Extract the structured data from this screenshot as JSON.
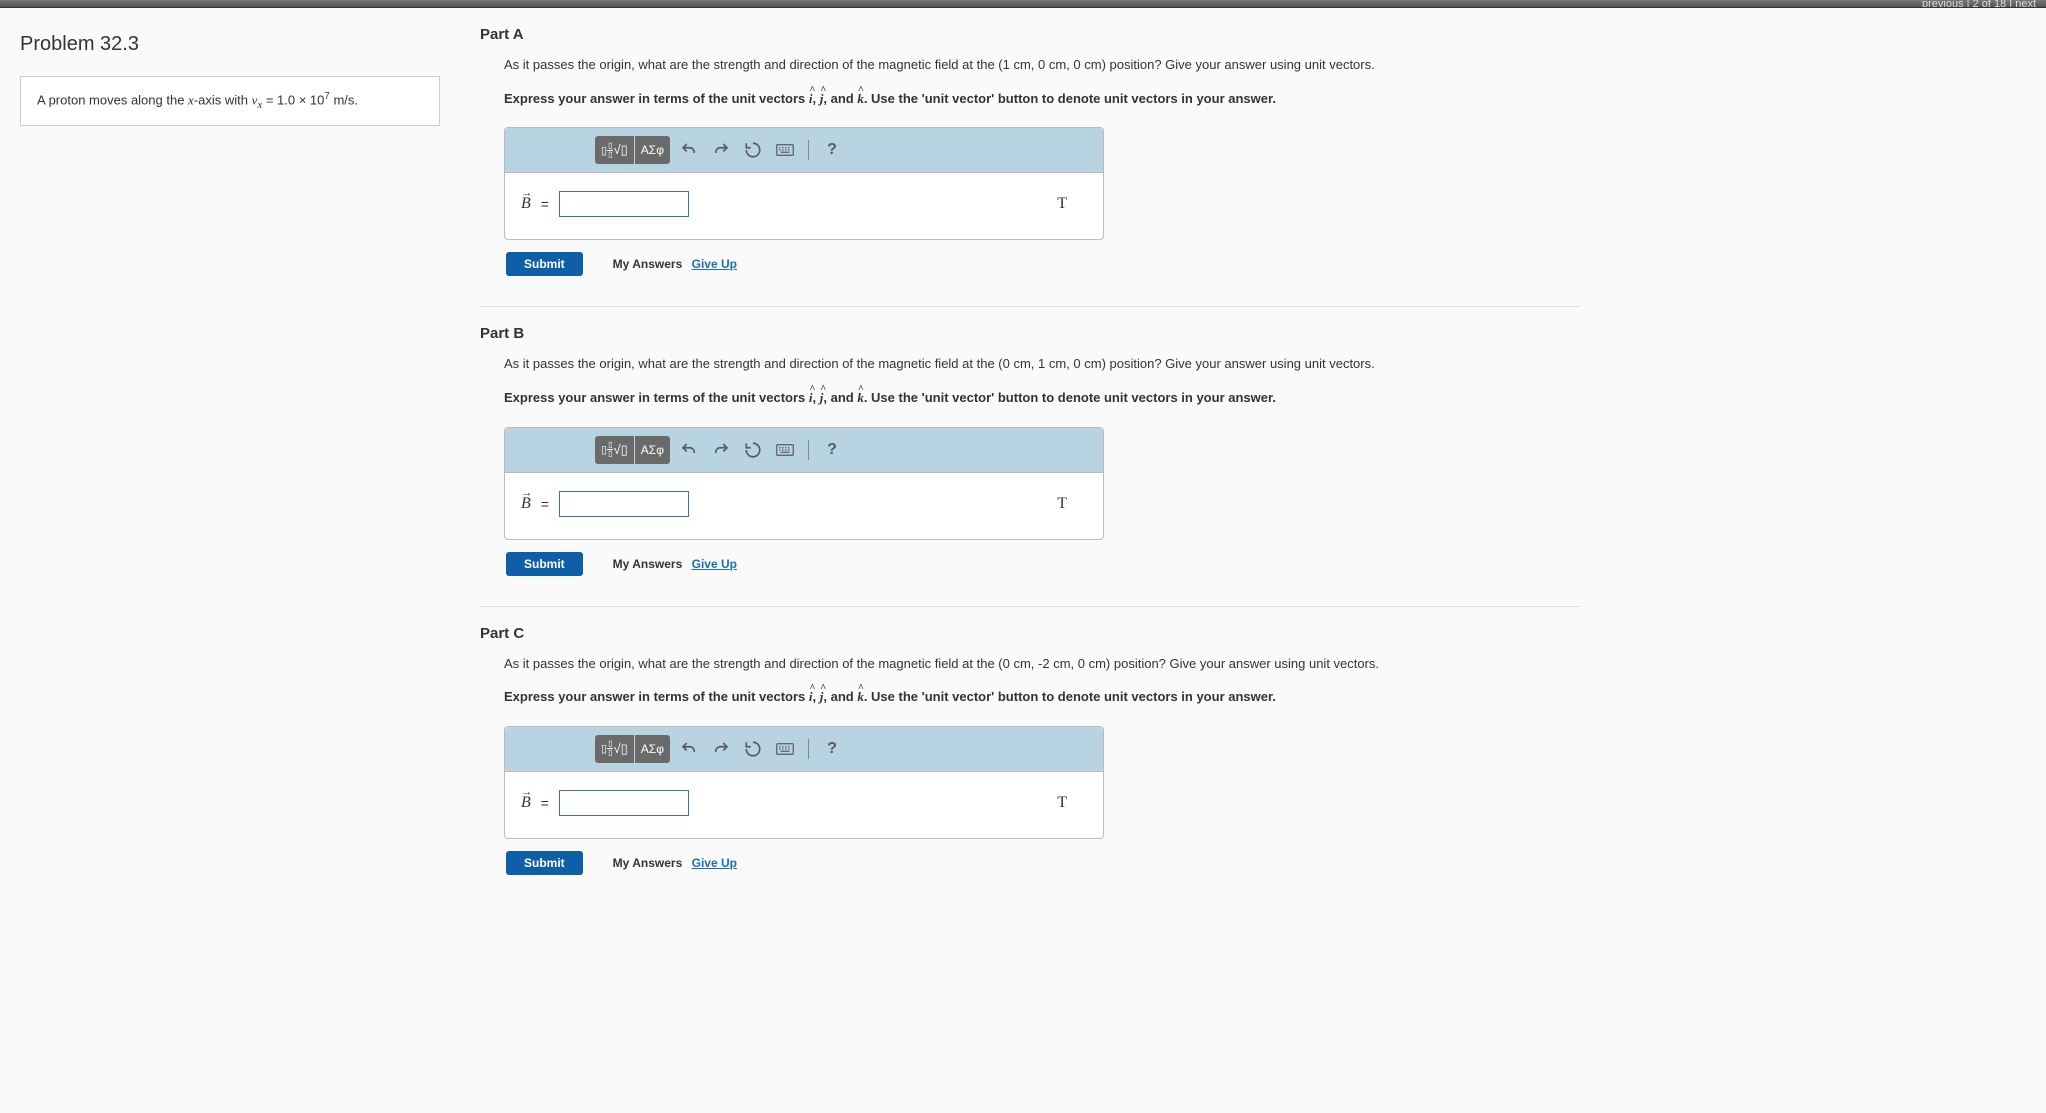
{
  "nav": {
    "prev": "previous",
    "pos": "2 of 18",
    "next": "next"
  },
  "problem": {
    "title": "Problem 32.3",
    "desc_pre": "A proton moves along the ",
    "desc_axis_var": "x",
    "desc_mid": "-axis with ",
    "desc_vel_var": "v",
    "desc_vel_sub": "x",
    "desc_eq": " = 1.0 × 10",
    "desc_exp": "7",
    "desc_unit": " m/s."
  },
  "common": {
    "instruction_pre": "Express your answer in terms of the unit vectors ",
    "uv_i": "i",
    "uv_j": "j",
    "uv_k": "k",
    "instruction_post": ". Use the 'unit vector' button to denote unit vectors in your answer.",
    "toolbar": {
      "greek": "ΑΣφ",
      "help": "?"
    },
    "var_label": "B",
    "equals": "=",
    "unit": "T",
    "submit": "Submit",
    "my_answers": "My Answers",
    "give_up": "Give Up"
  },
  "parts": [
    {
      "header": "Part A",
      "q_pre": "As it passes the origin, what are the strength and direction of the magnetic field at the (",
      "coords": "1 cm, 0 cm, 0 cm",
      "q_post": ") position? Give your answer using unit vectors."
    },
    {
      "header": "Part B",
      "q_pre": "As it passes the origin, what are the strength and direction of the magnetic field at the (",
      "coords": "0 cm, 1 cm, 0 cm",
      "q_post": ") position? Give your answer using unit vectors."
    },
    {
      "header": "Part C",
      "q_pre": "As it passes the origin, what are the strength and direction of the magnetic field at the (",
      "coords": "0 cm, -2 cm, 0 cm",
      "q_post": ") position? Give your answer using unit vectors."
    }
  ]
}
